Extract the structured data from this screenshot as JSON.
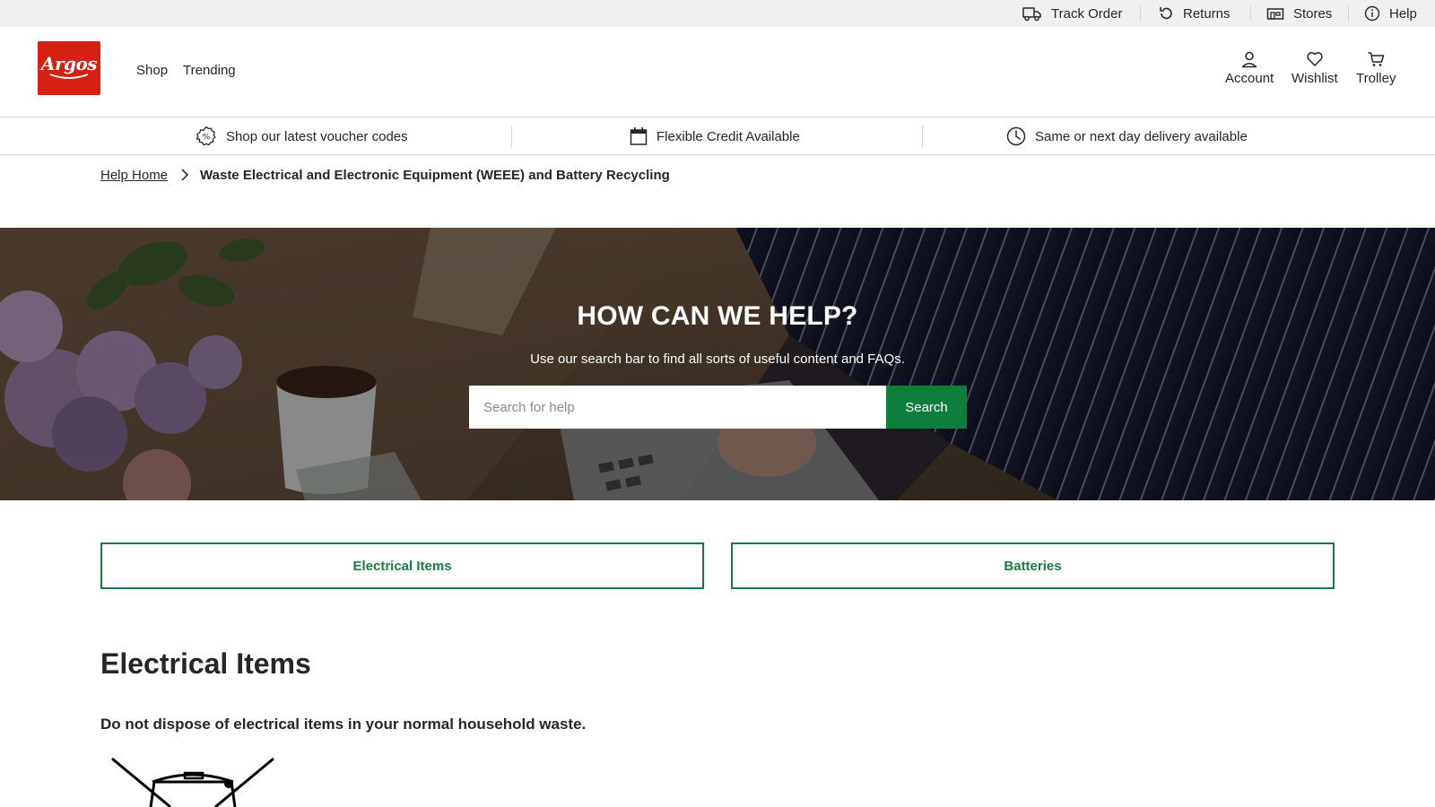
{
  "utility": {
    "links": [
      {
        "label": "Track Order",
        "icon": "truck-icon"
      },
      {
        "label": "Returns",
        "icon": "returns-icon"
      },
      {
        "label": "Stores",
        "icon": "store-icon"
      },
      {
        "label": "Help",
        "icon": "info-icon"
      }
    ]
  },
  "header": {
    "logo_text": "Argos",
    "nav": [
      "Shop",
      "Trending"
    ],
    "account_label": "Account",
    "wishlist_label": "Wishlist",
    "trolley_label": "Trolley"
  },
  "promo": {
    "items": [
      {
        "label": "Shop our latest voucher codes",
        "icon": "voucher-badge-icon"
      },
      {
        "label": "Flexible Credit Available",
        "icon": "calendar-icon"
      },
      {
        "label": "Same or next day delivery available",
        "icon": "clock-icon"
      }
    ]
  },
  "breadcrumb": {
    "home": "Help Home",
    "current": "Waste Electrical and Electronic Equipment (WEEE) and Battery Recycling"
  },
  "hero": {
    "title": "HOW CAN WE HELP?",
    "subtitle": "Use our search bar to find all sorts of useful content and FAQs.",
    "search_placeholder": "Search for help",
    "search_value": "",
    "search_button": "Search"
  },
  "anchors": [
    "Electrical Items",
    "Batteries"
  ],
  "content": {
    "title": "Electrical Items",
    "notice": "Do not dispose of electrical items in your normal household waste.",
    "image_icon": "crossed-out-wheelie-bin-icon"
  },
  "colors": {
    "brand_red": "#d42114",
    "action_green": "#0f7d3c",
    "outline_green": "#1a7a45",
    "utility_bg": "#f0f0f0"
  }
}
